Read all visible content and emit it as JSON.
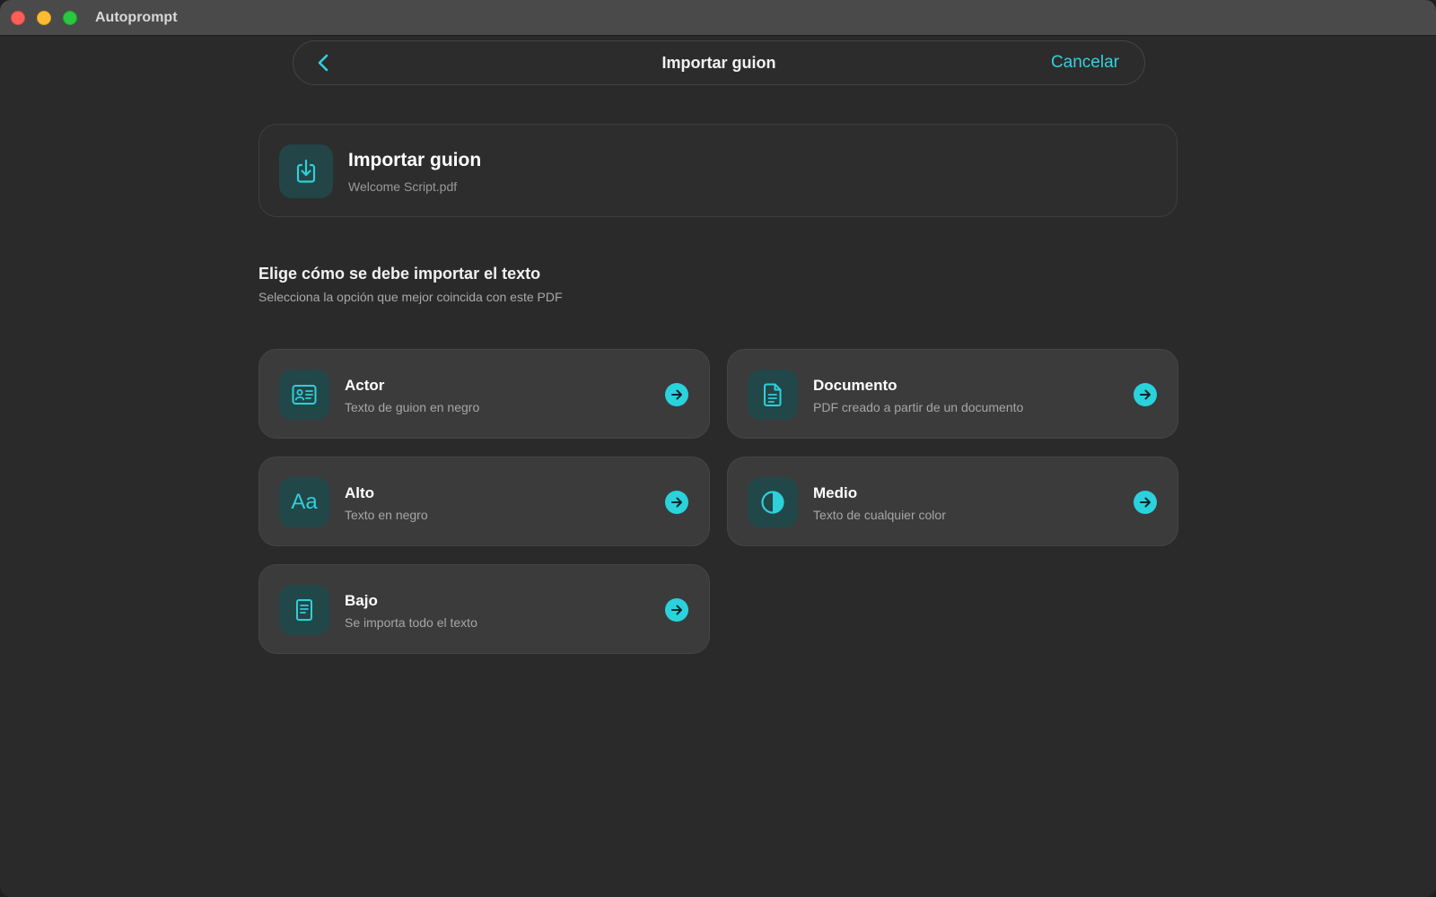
{
  "app": {
    "title": "Autoprompt"
  },
  "navbar": {
    "title": "Importar guion",
    "cancel_label": "Cancelar"
  },
  "file_card": {
    "title": "Importar guion",
    "file_name": "Welcome Script.pdf",
    "icon": "import-download-icon"
  },
  "section": {
    "title": "Elige cómo se debe importar el texto",
    "subtitle": "Selecciona la opción que mejor coincida con este PDF"
  },
  "options": [
    {
      "title": "Actor",
      "subtitle": "Texto de guion en negro",
      "icon": "id-card-icon"
    },
    {
      "title": "Documento",
      "subtitle": "PDF creado a partir de un documento",
      "icon": "document-icon"
    },
    {
      "title": "Alto",
      "subtitle": "Texto en negro",
      "icon": "text-aa-icon",
      "icon_text": "Aa"
    },
    {
      "title": "Medio",
      "subtitle": "Texto de cualquier color",
      "icon": "half-contrast-icon"
    },
    {
      "title": "Bajo",
      "subtitle": "Se importa todo el texto",
      "icon": "page-lines-icon"
    }
  ],
  "colors": {
    "accent": "#2ad2dc",
    "background": "#2a2a2b",
    "card": "#3b3b3c",
    "icon_tile": "#224749"
  }
}
